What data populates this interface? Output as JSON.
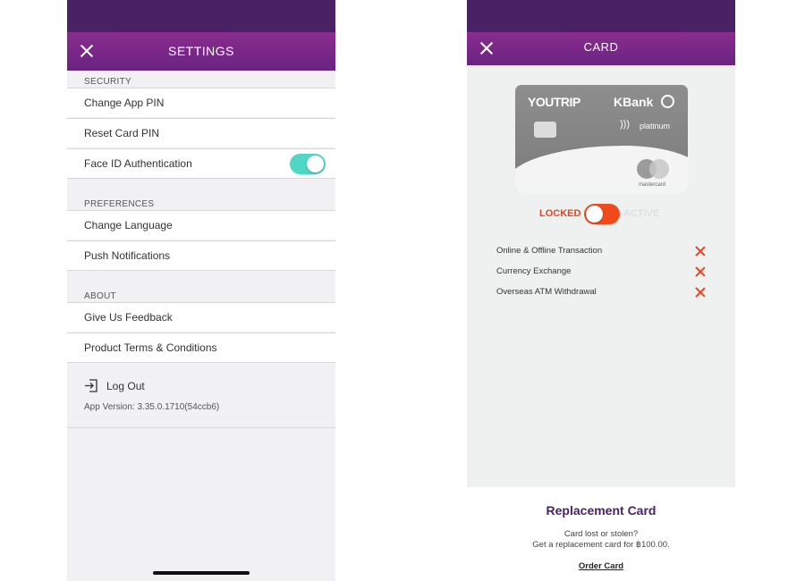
{
  "settings": {
    "title": "SETTINGS",
    "security": {
      "header": "SECURITY",
      "items": [
        "Change App PIN",
        "Reset Card PIN",
        "Face ID Authentication"
      ],
      "face_id_enabled": true
    },
    "preferences": {
      "header": "PREFERENCES",
      "items": [
        "Change Language",
        "Push Notifications"
      ]
    },
    "about": {
      "header": "ABOUT",
      "items": [
        "Give Us Feedback",
        "Product Terms & Conditions"
      ]
    },
    "logout_label": "Log Out",
    "app_version": "App Version: 3.35.0.1710(54ccb6)"
  },
  "card_screen": {
    "title": "CARD",
    "card": {
      "brand": "YOUTRIP",
      "bank": "KBank",
      "tier": "platinum",
      "network": "mastercard"
    },
    "lock_label": "LOCKED",
    "active_label": "ACTIVE",
    "locked": true,
    "features": [
      "Online & Offline Transaction",
      "Currency Exchange",
      "Overseas ATM Withdrawal"
    ],
    "replacement": {
      "title": "Replacement Card",
      "line1": "Card lost or stolen?",
      "line2": "Get a replacement card for ฿100.00.",
      "order_label": "Order Card"
    }
  },
  "colors": {
    "status_bar": "#4b2166",
    "nav_gradient_top": "#8a2c8f",
    "toggle_on": "#4fd6c4",
    "locked_red": "#e8421f",
    "title_purple": "#4b1d6b"
  }
}
